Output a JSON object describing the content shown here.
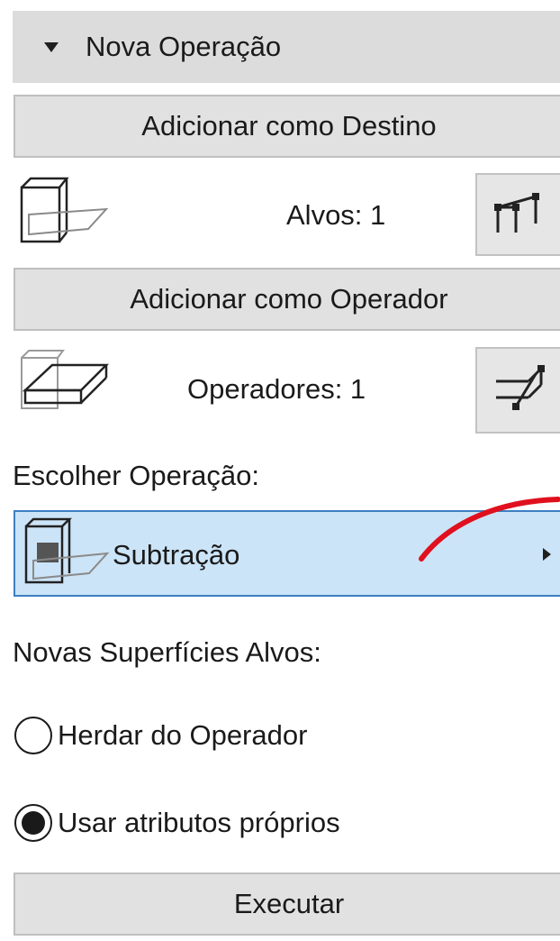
{
  "header": {
    "title": "Nova Operação"
  },
  "targets": {
    "add_label": "Adicionar como Destino",
    "count_label": "Alvos: 1"
  },
  "operators": {
    "add_label": "Adicionar como Operador",
    "count_label": "Operadores: 1"
  },
  "operation": {
    "section_label": "Escolher Operação:",
    "selected": "Subtração"
  },
  "surfaces": {
    "section_label": "Novas Superfícies Alvos:",
    "options": [
      {
        "label": "Herdar do Operador",
        "selected": false
      },
      {
        "label": "Usar atributos próprios",
        "selected": true
      }
    ]
  },
  "execute_label": "Executar",
  "colors": {
    "selection_fill": "#cce4f7",
    "selection_border": "#3c7fc1",
    "annotation": "#e0101e"
  },
  "icons": [
    "disclosure-triangle-icon",
    "target-slab-icon",
    "select-targets-icon",
    "operator-slab-icon",
    "select-operators-icon",
    "subtraction-icon",
    "submenu-arrow-icon"
  ]
}
